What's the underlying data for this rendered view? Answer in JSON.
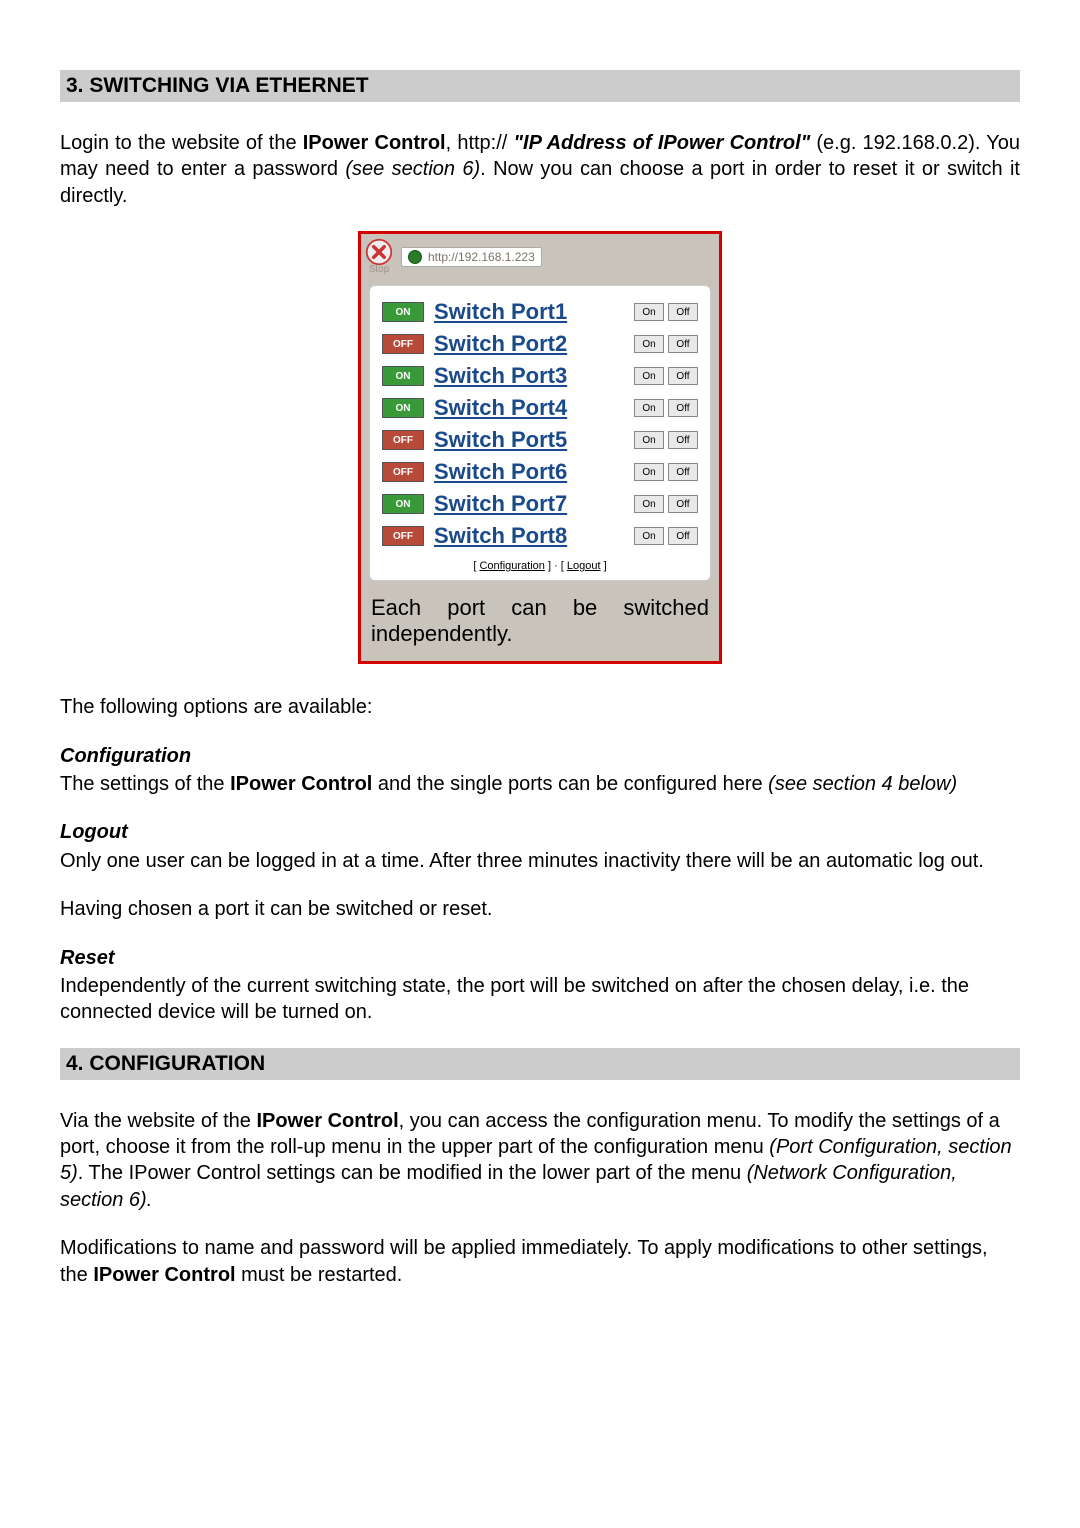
{
  "section3": {
    "header": "3. SWITCHING VIA ETHERNET",
    "intro_pre": "Login to the website of the ",
    "intro_bold1": "IPower Control",
    "intro_mid1": ", http:// ",
    "intro_ital1": "\"IP Address of IPower Control\"",
    "intro_mid2": " (e.g. 192.168.0.2). You may need to enter a password ",
    "intro_ital2": "(see section 6)",
    "intro_post": ". Now you can choose a port in order to reset it or switch it directly."
  },
  "figure": {
    "stop_label": "Stop",
    "url": "http://192.168.1.223",
    "ports": [
      {
        "state": "ON",
        "name": "Switch Port1"
      },
      {
        "state": "OFF",
        "name": "Switch Port2"
      },
      {
        "state": "ON",
        "name": "Switch Port3"
      },
      {
        "state": "ON",
        "name": "Switch Port4"
      },
      {
        "state": "OFF",
        "name": "Switch Port5"
      },
      {
        "state": "OFF",
        "name": "Switch Port6"
      },
      {
        "state": "ON",
        "name": "Switch Port7"
      },
      {
        "state": "OFF",
        "name": "Switch Port8"
      }
    ],
    "btn_on": "On",
    "btn_off": "Off",
    "footer_conf": "Configuration",
    "footer_sep": " ]  ·  [ ",
    "footer_logout": "Logout",
    "caption": "Each port can be switched independently."
  },
  "body": {
    "options_intro": "The following options are available:",
    "conf_head": "Configuration",
    "conf_pre": "The settings of the ",
    "conf_bold": "IPower Control",
    "conf_mid": " and the single ports can be configured here ",
    "conf_ital": "(see section 4 below)",
    "logout_head": "Logout",
    "logout_text": "Only one user can be logged in at a time. After three minutes inactivity there will be an automatic log out.",
    "chosen_text": "Having chosen a port it can be switched or reset.",
    "reset_head": "Reset",
    "reset_text": "Independently of the current switching state, the port will be switched on after the chosen delay, i.e. the connected device will be turned on."
  },
  "section4": {
    "header": "4. CONFIGURATION",
    "p1_pre": "Via the website of the ",
    "p1_bold": "IPower Control",
    "p1_mid1": ", you can access the configuration menu. To modify the settings of a port, choose it from the roll-up menu in the upper part of the configuration menu ",
    "p1_ital1": "(Port Configuration, section 5)",
    "p1_mid2": ". The IPower Control settings can be modified in the lower part of the menu ",
    "p1_ital2": "(Network Configuration, section 6).",
    "p2_pre": "Modifications to name and password will be applied immediately. To apply modifications to other settings, the ",
    "p2_bold": "IPower Control",
    "p2_post": " must be restarted."
  }
}
